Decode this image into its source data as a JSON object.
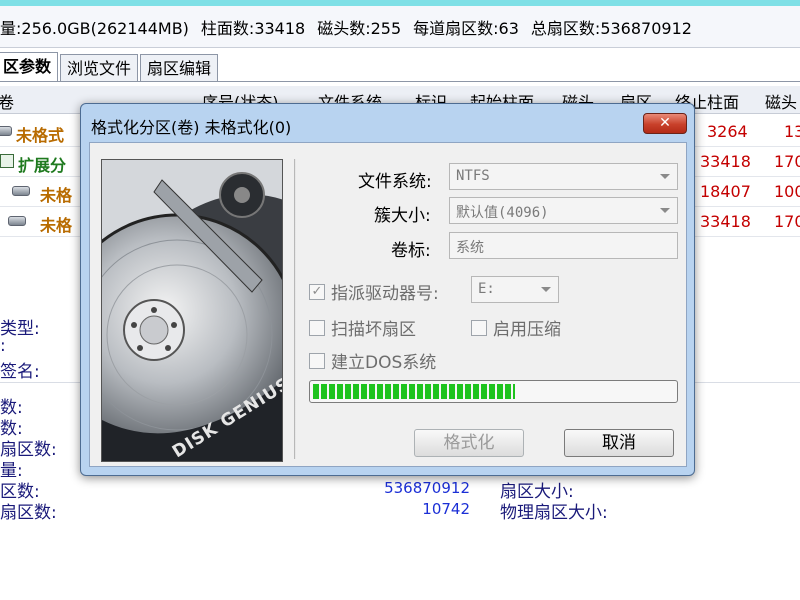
{
  "info_bar": {
    "capacity": "量:256.0GB(262144MB)",
    "cylinders": "柱面数:33418",
    "heads": "磁头数:255",
    "sectors_per_track": "每道扇区数:63",
    "total_sectors": "总扇区数:536870912"
  },
  "tabs": [
    "区参数",
    "浏览文件",
    "扇区编辑"
  ],
  "grid": {
    "headers": [
      "卷",
      "序号(状态)",
      "文件系统",
      "标识",
      "起始柱面",
      "磁头",
      "扇区",
      "终止柱面",
      "磁头"
    ],
    "rows": [
      {
        "label": "未格式",
        "end_cyl": "3264",
        "head": "13"
      },
      {
        "label": "扩展分",
        "end_cyl": "33418",
        "head": "170"
      },
      {
        "label": "未格",
        "end_cyl": "18407",
        "head": "100"
      },
      {
        "label": "未格",
        "end_cyl": "33418",
        "head": "170"
      }
    ]
  },
  "bottom": {
    "left_labels_top": [
      "类型:",
      ":",
      "签名:"
    ],
    "left_labels_bottom": [
      "数:",
      "数:",
      "扇区数:",
      "量:",
      "区数:",
      "扇区数:"
    ],
    "values": [
      "536870912",
      "10742"
    ],
    "right_labels": [
      "扇区大小:",
      "物理扇区大小:"
    ]
  },
  "dialog": {
    "title": "格式化分区(卷) 未格式化(0)",
    "close": "✕",
    "filesystem_label": "文件系统:",
    "filesystem_value": "NTFS",
    "cluster_label": "簇大小:",
    "cluster_value": "默认值(4096)",
    "volume_label": "卷标:",
    "volume_value": "系统",
    "assign_drive_label": "指派驱动器号:",
    "assign_drive_value": "E:",
    "assign_drive_checked": "✓",
    "scan_bad_label": "扫描坏扇区",
    "compress_label": "启用压缩",
    "dos_label": "建立DOS系统",
    "progress": 0.56,
    "format_button": "格式化",
    "cancel_button": "取消",
    "brand_text": "DISK GENIUS"
  }
}
